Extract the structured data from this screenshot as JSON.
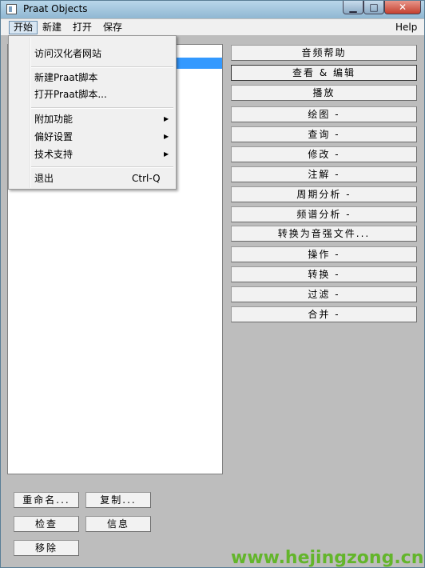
{
  "window": {
    "title": "Praat Objects",
    "controls": {
      "min": "▁",
      "max": "□",
      "close": "✕"
    }
  },
  "menubar": {
    "items": [
      "开始",
      "新建",
      "打开",
      "保存"
    ],
    "help": "Help"
  },
  "dropdown": {
    "visit_site": "访问汉化者网站",
    "new_script": "新建Praat脚本",
    "open_script": "打开Praat脚本...",
    "extras": "附加功能",
    "preferences": "偏好设置",
    "tech_support": "技术支持",
    "quit": "退出",
    "quit_shortcut": "Ctrl-Q",
    "submenu_arrow": "▶"
  },
  "actions": {
    "sound_help": "音频帮助",
    "view_edit": "查看 & 编辑",
    "play": "播放",
    "draw": "绘图 -",
    "query": "查询 -",
    "modify": "修改 -",
    "annotate": "注解 -",
    "periodicity": "周期分析 -",
    "spectrum": "频谱分析 -",
    "to_intensity": "转换为音强文件...",
    "operate": "操作 -",
    "convert": "转换 -",
    "filter": "过滤 -",
    "combine": "合并 -"
  },
  "bottom_buttons": {
    "rename": "重命名...",
    "copy": "复制...",
    "inspect": "检查",
    "info": "信息",
    "remove": "移除"
  },
  "watermark": "www.hejingzong.cn",
  "colors": {
    "selection": "#3399ff",
    "watermark": "#63b52b",
    "close_button": "#c4402f"
  }
}
